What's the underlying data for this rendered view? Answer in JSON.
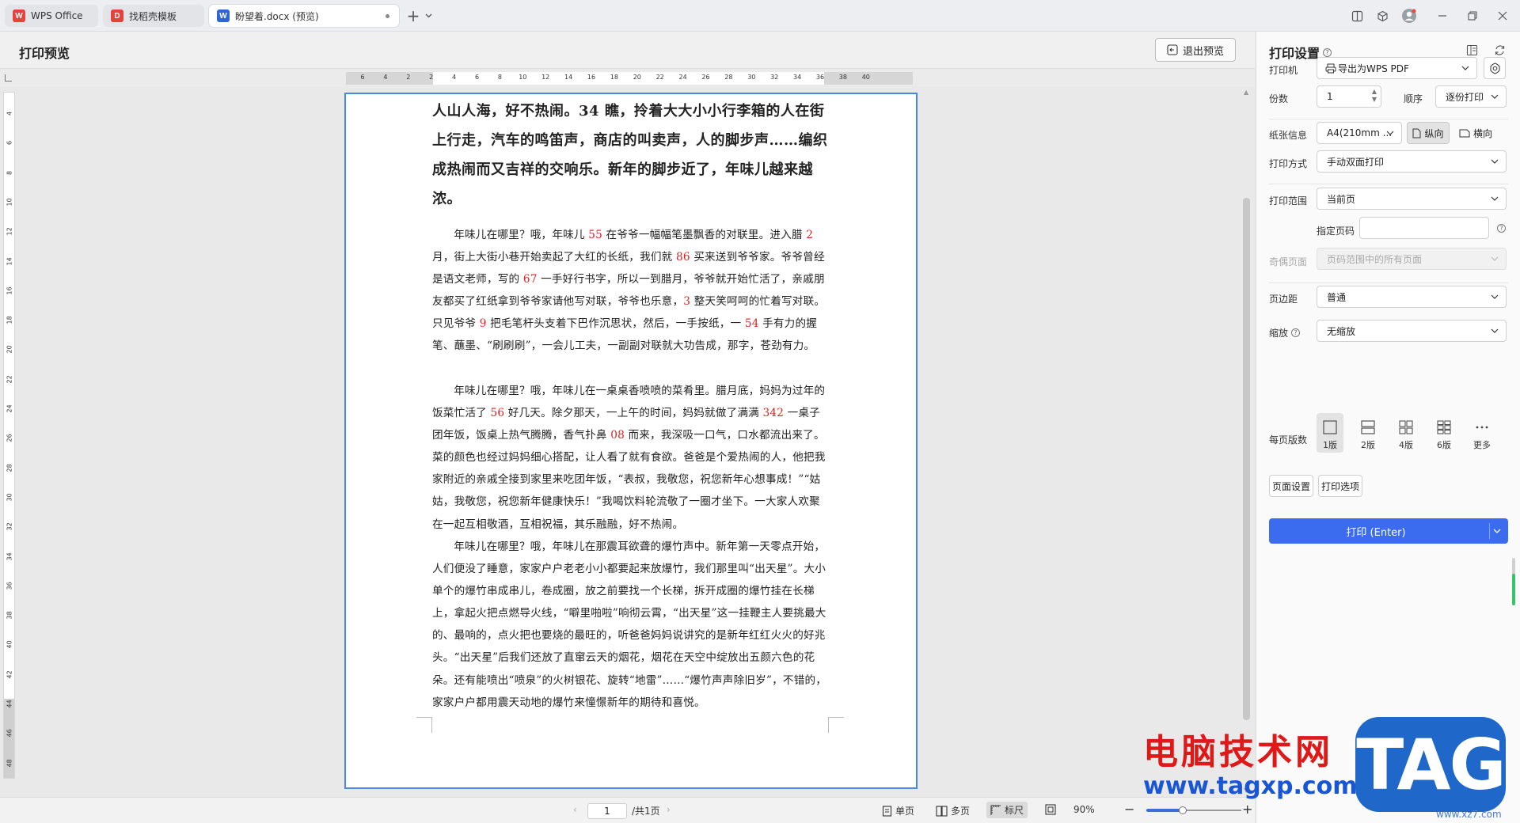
{
  "titlebar": {
    "tabs": [
      {
        "label": "WPS Office",
        "icon": "wps-logo-icon",
        "color": "#e8413b"
      },
      {
        "label": "找稻壳模板",
        "icon": "docer-logo-icon",
        "color": "#e8413b"
      },
      {
        "label": "盼望着.docx (预览)",
        "icon": "word-doc-icon",
        "color": "#2f64d8"
      }
    ],
    "new_tab": "+",
    "window_controls": [
      "layout-icon",
      "cube-icon",
      "avatar",
      "minimize-icon",
      "restore-icon",
      "close-icon"
    ]
  },
  "header": {
    "title": "打印预览",
    "exit_button": "退出预览"
  },
  "ruler": {
    "h_ticks": [
      "6",
      "4",
      "2",
      "2",
      "4",
      "6",
      "8",
      "10",
      "12",
      "14",
      "16",
      "18",
      "20",
      "22",
      "24",
      "26",
      "28",
      "30",
      "32",
      "34",
      "36",
      "38",
      "40"
    ],
    "v_ticks": [
      "4",
      "6",
      "8",
      "10",
      "12",
      "14",
      "16",
      "18",
      "20",
      "22",
      "24",
      "26",
      "28",
      "30",
      "32",
      "34",
      "36",
      "38",
      "40",
      "42",
      "44",
      "46",
      "48"
    ]
  },
  "document": {
    "heading": "人山人海，好不热闹。34 瞧，拎着大大小小行李箱的人在街上行走，汽车的鸣笛声，商店的叫卖声，人的脚步声……编织成热闹而又吉祥的交响乐。新年的脚步近了，年味儿越来越浓。",
    "paragraphs": [
      [
        {
          "t": "年味儿在哪里？哦，年味儿 "
        },
        {
          "t": "55",
          "red": true
        },
        {
          "t": " 在爷爷一幅幅笔墨飘香的对联里。进入腊 "
        },
        {
          "t": "2",
          "red": true
        },
        {
          "t": "月，街上大街小巷开始卖起了大红的长纸，我们就 "
        },
        {
          "t": "86",
          "red": true
        },
        {
          "t": " 买来送到爷爷家。爷爷曾经是语文老师，写的 "
        },
        {
          "t": "67",
          "red": true
        },
        {
          "t": " 一手好行书字，所以一到腊月，爷爷就开始忙活了，亲戚朋友都买了红纸拿到爷爷家请他写对联，爷爷也乐意，"
        },
        {
          "t": "3",
          "red": true
        },
        {
          "t": " 整天笑呵呵的忙着写对联。只见爷爷 "
        },
        {
          "t": "9",
          "red": true
        },
        {
          "t": " 把毛笔杆头支着下巴作沉思状，然后，一手按纸，一 "
        },
        {
          "t": "54",
          "red": true
        },
        {
          "t": " 手有力的握笔、蘸墨、“刷刷刷”，一会儿工夫，一副副对联就大功告成，那字，苍劲有力。"
        }
      ],
      [
        {
          "t": "年味儿在哪里？哦，年味儿在一桌桌香喷喷的菜肴里。腊月底，妈妈为过年的饭菜忙活了 "
        },
        {
          "t": "56",
          "red": true
        },
        {
          "t": " 好几天。除夕那天，一上午的时间，妈妈就做了满满 "
        },
        {
          "t": "342",
          "red": true
        },
        {
          "t": " 一桌子团年饭，饭桌上热气腾腾，香气扑鼻 "
        },
        {
          "t": "08",
          "red": true
        },
        {
          "t": " 而来，我深吸一口气，口水都流出来了。菜的颜色也经过妈妈细心搭配，让人看了就有食欲。爸爸是个爱热闹的人，他把我家附近的亲戚全接到家里来吃团年饭，“表叔，我敬您，祝您新年心想事成！”“姑姑，我敬您，祝您新年健康快乐！”我喝饮料轮流敬了一圈才坐下。一大家人欢聚在一起互相敬酒，互相祝福，其乐融融，好不热闹。"
        }
      ],
      [
        {
          "t": "年味儿在哪里？哦，年味儿在那震耳欲聋的爆竹声中。新年第一天零点开始，人们便没了睡意，家家户户老老小小都要起来放爆竹，我们那里叫“出天星”。大小单个的爆竹串成串儿，卷成圈，放之前要找一个长梯，拆开成圈的爆竹挂在长梯上，拿起火把点燃导火线，“噼里啪啦”响彻云霄，“出天星”这一挂鞭主人要挑最大的、最响的，点火把也要烧的最旺的，听爸爸妈妈说讲究的是新年红红火火的好兆头。“出天星”后我们还放了直窜云天的烟花，烟花在天空中绽放出五颜六色的花朵。还有能喷出“喷泉”的火树银花、旋转“地雷”……“爆竹声声除旧岁”，不错的，家家户户都用震天动地的爆竹来憧憬新年的期待和喜悦。"
        }
      ]
    ]
  },
  "statusbar": {
    "page_current": "1",
    "page_total": "/共1页",
    "single_page": "单页",
    "multi_page": "多页",
    "ruler": "标尺",
    "zoom": "90%",
    "zoom_level": 0.38
  },
  "panel": {
    "title": "打印设置",
    "printer_label": "打印机",
    "printer_value": "导出为WPS PDF",
    "copies_label": "份数",
    "copies_value": "1",
    "order_label": "顺序",
    "order_value": "逐份打印",
    "paper_label": "纸张信息",
    "paper_value": "A4(210mm ...",
    "portrait": "纵向",
    "landscape": "横向",
    "method_label": "打印方式",
    "method_value": "手动双面打印",
    "range_label": "打印范围",
    "range_value": "当前页",
    "pages_label": "指定页码",
    "pages_value": "",
    "oddeven_label": "奇偶页面",
    "oddeven_value": "页码范围中的所有页面",
    "margin_label": "页边距",
    "margin_value": "普通",
    "scale_label": "缩放",
    "scale_value": "无缩放",
    "perpage_label": "每页版数",
    "perpage_options": [
      "1版",
      "2版",
      "4版",
      "6版",
      "更多"
    ],
    "page_setup": "页面设置",
    "print_options": "打印选项",
    "print_button": "打印 (Enter)"
  },
  "watermark": {
    "cn": "电脑技术网",
    "url": "www.tagxp.com",
    "tag": "TAG",
    "sub": "www.xz7.com"
  }
}
